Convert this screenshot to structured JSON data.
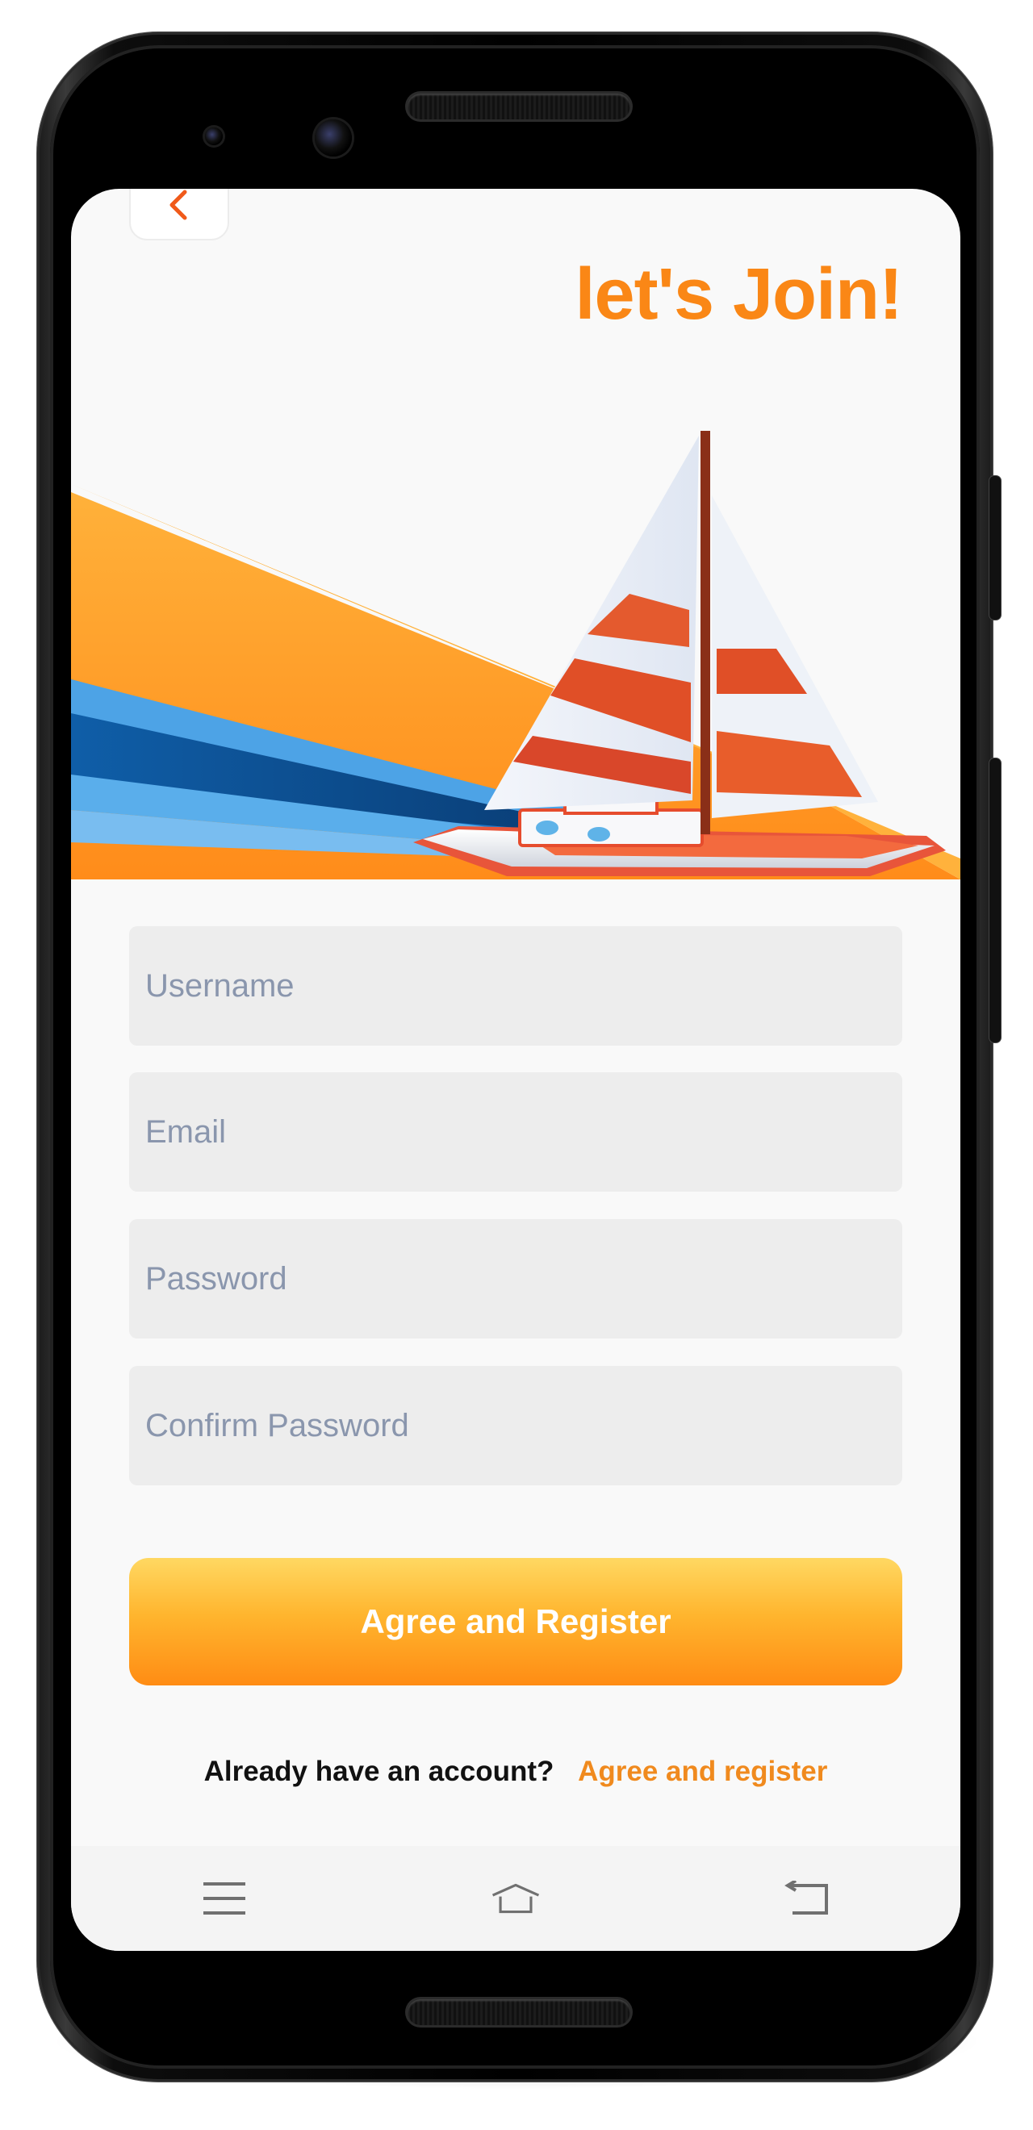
{
  "screen": {
    "title": "let's Join!"
  },
  "form": {
    "username_placeholder": "Username",
    "email_placeholder": "Email",
    "password_placeholder": "Password",
    "confirm_password_placeholder": "Confirm Password"
  },
  "actions": {
    "register_label": "Agree and Register",
    "already_text": "Already have an account?",
    "login_link": "Agree and register"
  },
  "icons": {
    "back": "chevron-left-icon",
    "nav_menu": "menu-icon",
    "nav_home": "home-icon",
    "nav_back": "back-arrow-icon"
  },
  "colors": {
    "accent": "#fa8716",
    "button_top": "#ffd862",
    "button_bottom": "#ff8c14",
    "field_bg": "#ededed",
    "placeholder": "#8a96ad",
    "link": "#f08a1e"
  }
}
